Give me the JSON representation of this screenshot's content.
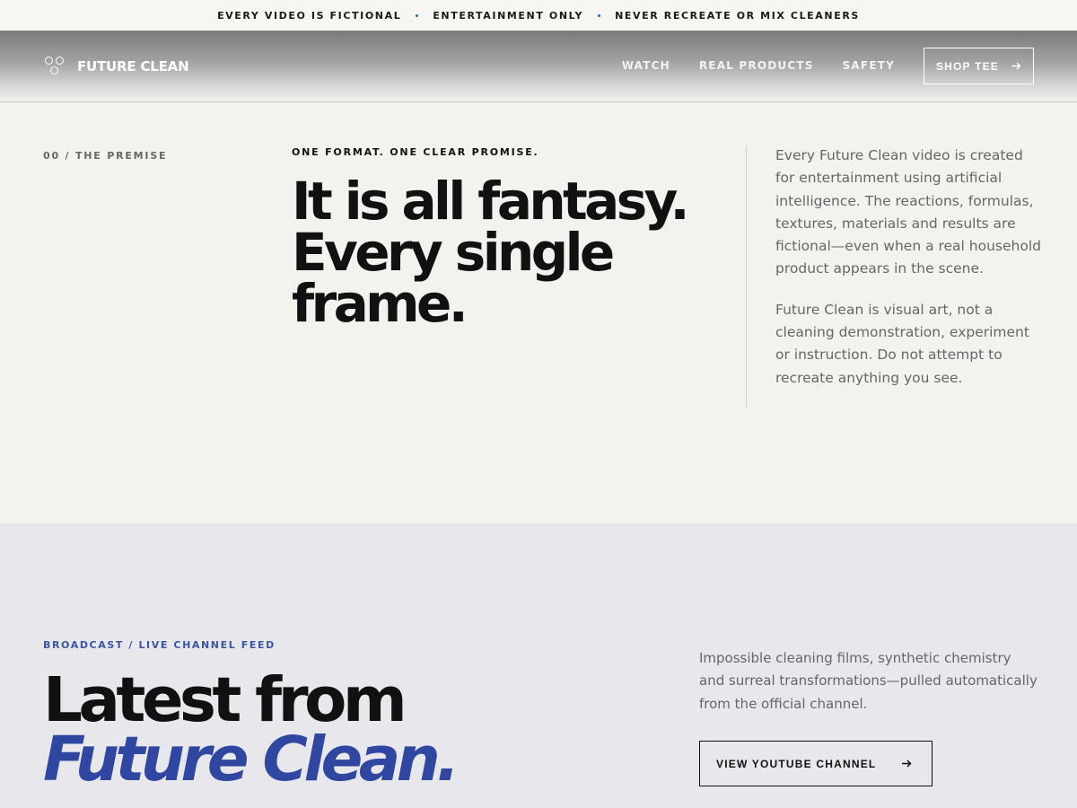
{
  "announcement": {
    "items": [
      "EVERY VIDEO IS FICTIONAL",
      "ENTERTAINMENT ONLY",
      "NEVER RECREATE OR MIX CLEANERS"
    ]
  },
  "nav": {
    "logo_text": "FUTURE CLEAN",
    "links": [
      "WATCH",
      "REAL PRODUCTS",
      "SAFETY"
    ],
    "shop_label": "SHOP TEE",
    "shop_icon": "arrow-right-icon"
  },
  "premise": {
    "kicker": "00 / THE PREMISE",
    "format_kicker": "ONE FORMAT. ONE CLEAR PROMISE.",
    "headline": "It is all fantasy. Every single frame.",
    "paragraphs": [
      "Every Future Clean video is created for entertainment using artificial intelligence. The reactions, formulas, textures, materials and results are fictional—even when a real household product appears in the scene.",
      "Future Clean is visual art, not a cleaning demonstration, experiment or instruction. Do not attempt to recreate anything you see."
    ]
  },
  "feed": {
    "kicker": "BROADCAST / LIVE CHANNEL FEED",
    "title_line1": "Latest from",
    "title_line2": "Future Clean.",
    "description": "Impossible cleaning films, synthetic chemistry and surreal transformations—pulled automatically from the official channel.",
    "button_label": "VIEW YOUTUBE CHANNEL",
    "button_icon": "arrow-right-icon"
  },
  "colors": {
    "accent": "#2f47a0",
    "kicker_blue": "#3a55a8",
    "announcement_dot": "#2f63c9"
  }
}
